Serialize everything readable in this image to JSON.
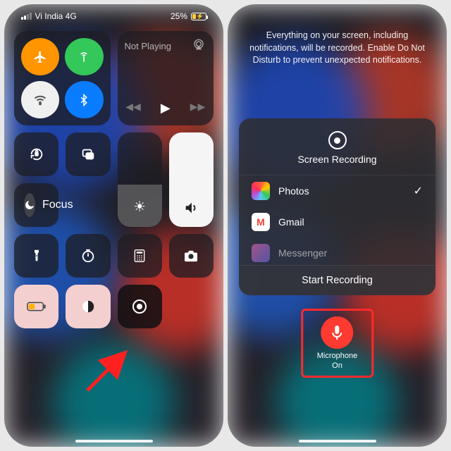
{
  "status": {
    "carrier": "Vi India 4G",
    "battery_pct": "25%"
  },
  "music": {
    "title": "Not Playing"
  },
  "focus": {
    "label": "Focus"
  },
  "recording_msg": "Everything on your screen, including notifications, will be recorded. Enable Do Not Disturb to prevent unexpected notifications.",
  "sheet": {
    "title": "Screen Recording",
    "apps": [
      {
        "name": "Photos",
        "selected": true
      },
      {
        "name": "Gmail",
        "selected": false
      },
      {
        "name": "Messenger",
        "selected": false
      }
    ],
    "start_label": "Start Recording"
  },
  "mic": {
    "label": "Microphone",
    "state": "On"
  },
  "colors": {
    "airplane": "#ff9500",
    "cellular": "#34c759",
    "wifi": "#f0f0f0",
    "bluetooth": "#0a7cff",
    "pink": "#f4cfcf",
    "red": "#ff3a30"
  }
}
